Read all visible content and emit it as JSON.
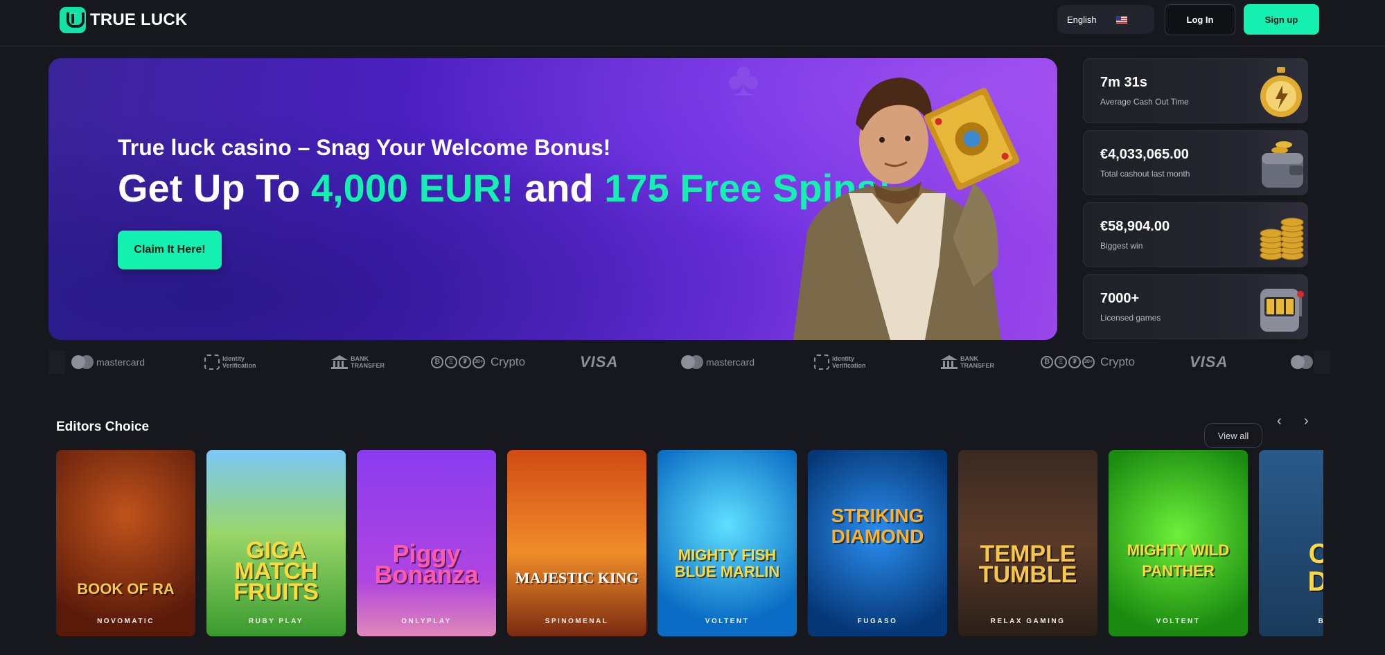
{
  "header": {
    "logo_text": "TRUE LUCK",
    "language": "English",
    "login_label": "Log In",
    "signup_label": "Sign up"
  },
  "hero": {
    "subtitle": "True luck casino – Snag Your Welcome Bonus!",
    "headline_a": "Get Up To ",
    "headline_b": "4,000 EUR!",
    "headline_c": " and ",
    "headline_d": "175 Free Spins!",
    "cta_label": "Claim It Here!",
    "accent_color": "#14f0b0"
  },
  "stats": [
    {
      "value": "7m 31s",
      "label": "Average Cash Out Time",
      "icon": "stopwatch-icon"
    },
    {
      "value": "€4,033,065.00",
      "label": "Total cashout last month",
      "icon": "wallet-icon"
    },
    {
      "value": "€58,904.00",
      "label": "Biggest win",
      "icon": "coins-icon"
    },
    {
      "value": "7000+",
      "label": "Licensed games",
      "icon": "slot-machine-icon"
    }
  ],
  "payments": {
    "mastercard": "mastercard",
    "idv_top": "Identity",
    "idv_bottom": "Verification",
    "bank_top": "BANK",
    "bank_bottom": "TRANSFER",
    "crypto_badge": "30+",
    "crypto": "Crypto",
    "visa": "VISA"
  },
  "editors_choice": {
    "title": "Editors Choice",
    "view_all": "View all",
    "prev_icon": "chevron-left-icon",
    "next_icon": "chevron-right-icon",
    "games": [
      {
        "title": "BOOK OF RA",
        "provider": "NOVOMATIC"
      },
      {
        "title": "GIGA MATCH FRUITS",
        "provider": "RUBY PLAY"
      },
      {
        "title": "Piggy Bonanza",
        "provider": "ONLYPLAY"
      },
      {
        "title": "MAJESTIC KING",
        "provider": "SPINOMENAL"
      },
      {
        "title": "MIGHTY FISH BLUE MARLIN",
        "provider": "VOLTENT"
      },
      {
        "title": "STRIKING DIAMOND",
        "provider": "FUGASO"
      },
      {
        "title": "TEMPLE TUMBLE",
        "provider": "RELAX GAMING"
      },
      {
        "title": "MIGHTY WILD PANTHER",
        "provider": "VOLTENT"
      },
      {
        "title": "CA\nDO",
        "provider": "BGA"
      }
    ]
  }
}
